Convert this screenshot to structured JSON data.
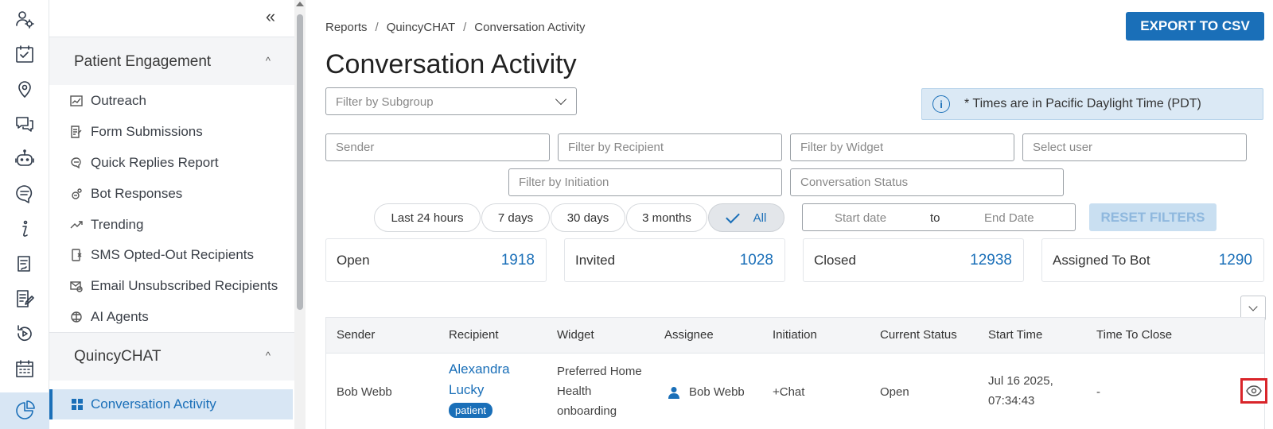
{
  "rail": {
    "icons": [
      "user-settings-icon",
      "calendar-check-icon",
      "location-pin-icon",
      "chat-bubbles-icon",
      "bot-icon",
      "message-icon",
      "info-icon",
      "clipboard-icon",
      "form-edit-icon",
      "replay-icon",
      "calendar-grid-icon",
      "pie-chart-icon"
    ]
  },
  "sidebar": {
    "sections": [
      {
        "title": "Patient Engagement",
        "items": [
          {
            "label": "Outreach",
            "icon": "chart-icon"
          },
          {
            "label": "Form Submissions",
            "icon": "form-icon"
          },
          {
            "label": "Quick Replies Report",
            "icon": "quick-reply-icon"
          },
          {
            "label": "Bot Responses",
            "icon": "bot-response-icon"
          },
          {
            "label": "Trending",
            "icon": "trending-icon"
          },
          {
            "label": "SMS Opted-Out Recipients",
            "icon": "sms-optout-icon"
          },
          {
            "label": "Email Unsubscribed Recipients",
            "icon": "email-unsub-icon"
          },
          {
            "label": "AI Agents",
            "icon": "ai-agent-icon"
          }
        ]
      },
      {
        "title": "QuincyCHAT",
        "items": [
          {
            "label": "Conversation Activity",
            "icon": "grid-icon",
            "active": true
          }
        ]
      }
    ]
  },
  "breadcrumb": [
    "Reports",
    "QuincyCHAT",
    "Conversation Activity"
  ],
  "page_title": "Conversation Activity",
  "export_label": "EXPORT TO CSV",
  "filters": {
    "subgroup_placeholder": "Filter by Subgroup",
    "timezone_note": "* Times are in Pacific Daylight Time (PDT)",
    "sender_placeholder": "Sender",
    "recipient_placeholder": "Filter by Recipient",
    "widget_placeholder": "Filter by Widget",
    "user_placeholder": "Select user",
    "initiation_placeholder": "Filter by Initiation",
    "status_placeholder": "Conversation Status",
    "time_ranges": [
      "Last 24 hours",
      "7 days",
      "30 days",
      "3 months",
      "All"
    ],
    "selected_range": "All",
    "start_date_placeholder": "Start date",
    "date_separator": "to",
    "end_date_placeholder": "End Date",
    "reset_label": "RESET FILTERS"
  },
  "stats": [
    {
      "label": "Open",
      "value": "1918"
    },
    {
      "label": "Invited",
      "value": "1028"
    },
    {
      "label": "Closed",
      "value": "12938"
    },
    {
      "label": "Assigned To Bot",
      "value": "1290"
    }
  ],
  "table": {
    "columns": [
      "Sender",
      "Recipient",
      "Widget",
      "Assignee",
      "Initiation",
      "Current Status",
      "Start Time",
      "Time To Close"
    ],
    "rows": [
      {
        "sender": "Bob Webb",
        "recipient_line1": "Alexandra",
        "recipient_line2": "Lucky",
        "recipient_tag": "patient",
        "widget_line1": "Preferred Home",
        "widget_line2": "Health",
        "widget_line3": "onboarding",
        "assignee": "Bob Webb",
        "initiation": "+Chat",
        "status": "Open",
        "start_line1": "Jul 16 2025,",
        "start_line2": "07:34:43",
        "time_to_close": "-"
      }
    ]
  },
  "colors": {
    "accent": "#1a6fb8",
    "active_bg": "#d8e6f4",
    "highlight": "#d9252a"
  }
}
